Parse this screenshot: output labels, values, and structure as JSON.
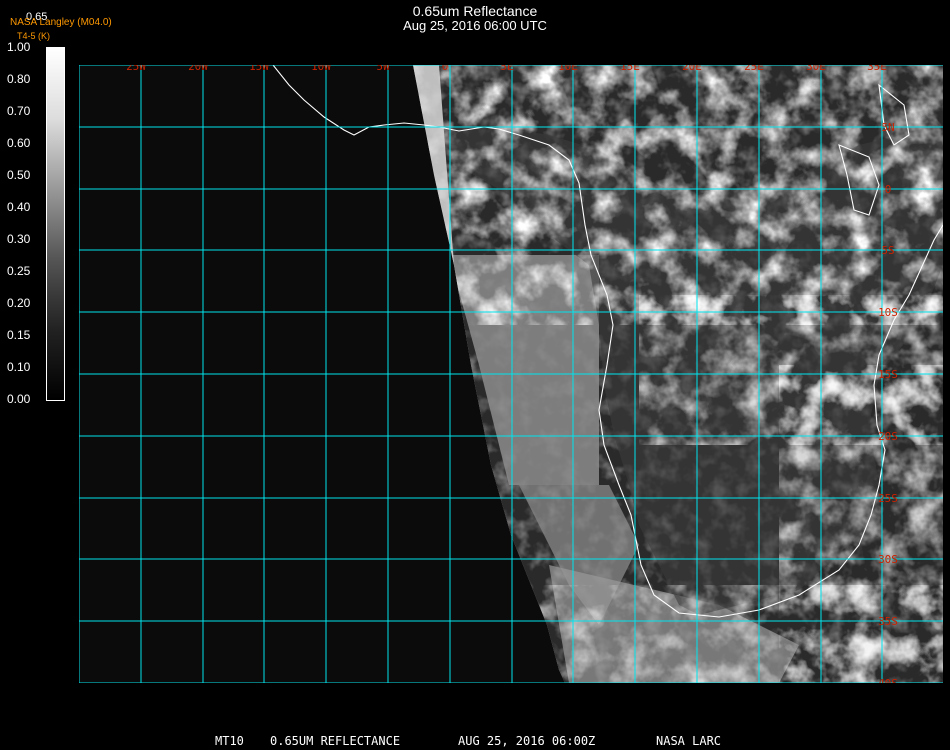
{
  "header": {
    "title": "0.65um Reflectance",
    "datetime": "Aug 25, 2016 06:00 UTC",
    "band": "0.65",
    "credit": "NASA Langley (M04.0)",
    "sub": "T4-5 (K)"
  },
  "colorbar": {
    "ticks": [
      "1.00",
      "0.80",
      "0.70",
      "0.60",
      "0.50",
      "0.40",
      "0.30",
      "0.25",
      "0.20",
      "0.15",
      "0.10",
      "0.00"
    ]
  },
  "map": {
    "lon_labels": [
      "25W",
      "20W",
      "15W",
      "10W",
      "5W",
      "0",
      "5E",
      "10E",
      "15E",
      "20E",
      "25E",
      "30E",
      "35E"
    ],
    "lat_labels": [
      "5N",
      "0",
      "5S",
      "10S",
      "15S",
      "20S",
      "25S",
      "30S",
      "35S",
      "40S"
    ],
    "grid_color": "#00e5ee",
    "label_color": "#cc2200",
    "coast_color": "#ffffff"
  },
  "footer": {
    "product": "MT10",
    "desc": "0.65UM REFLECTANCE",
    "date": "AUG 25, 2016 06:00Z",
    "org": "NASA LARC"
  }
}
